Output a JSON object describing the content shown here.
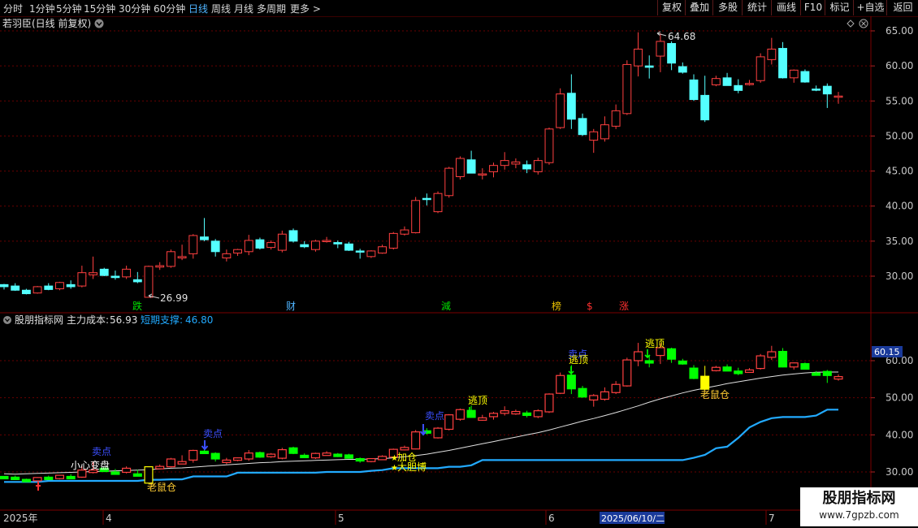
{
  "toolbar": {
    "periods": [
      "分时",
      "1分钟",
      "5分钟",
      "15分钟",
      "30分钟",
      "60分钟",
      "日线",
      "周线",
      "月线",
      "多周期",
      "更多"
    ],
    "active_period": "日线",
    "right_buttons": [
      "复权",
      "叠加",
      "多股",
      "统计",
      "画线",
      "F10",
      "标记",
      "+自选",
      "返回"
    ]
  },
  "main_panel": {
    "title": "若羽臣(日线 前复权)",
    "y_axis": {
      "min": 26,
      "max": 66,
      "ticks": [
        "65.00",
        "60.00",
        "55.00",
        "50.00",
        "45.00",
        "40.00",
        "35.00",
        "30.00"
      ]
    },
    "high_label": "64.68",
    "low_label": "26.99",
    "event_markers": [
      {
        "label": "跌",
        "color": "#00e000"
      },
      {
        "label": "财",
        "color": "#4fb4ff"
      },
      {
        "label": "減",
        "color": "#00e000"
      },
      {
        "label": "榜",
        "color": "#e8c000"
      },
      {
        "label": "$",
        "color": "#ff3030"
      },
      {
        "label": "涨",
        "color": "#ff3030"
      }
    ]
  },
  "indicator_panel": {
    "name": "股朋指标网",
    "main_cost_label": "主力成本:",
    "main_cost_value": "56.93",
    "support_label": "短期支撑:",
    "support_value": "46.80",
    "current_value_badge": "60.15",
    "y_axis": {
      "min": 26,
      "max": 64,
      "ticks": [
        "60.00",
        "50.00",
        "40.00",
        "30.00"
      ]
    },
    "signals": {
      "xiaoxin": "小心变盘",
      "maidian": "卖点",
      "laoshucang": "老鼠仓",
      "jiacang": "加仓",
      "dadanbo": "大胆博",
      "taoding": "逃顶"
    }
  },
  "time_axis": {
    "labels": [
      "2025年",
      "4",
      "5",
      "6",
      "2025/06/10/二",
      "7"
    ],
    "highlighted": "2025/06/10/二"
  },
  "watermark": {
    "name": "股朋指标网",
    "url": "www.7gpzb.com"
  },
  "colors": {
    "up": "#ff4040",
    "down": "#54ffff",
    "green": "#00ff00",
    "yellow": "#ffff00",
    "support": "#22aaff",
    "cost": "#e0e0e0",
    "grid": "#6a0000"
  },
  "chart_data": {
    "type": "candlestick",
    "ohlc": [
      [
        28.8,
        28.9,
        28.1,
        28.5
      ],
      [
        28.6,
        29.0,
        27.9,
        28.0
      ],
      [
        28.0,
        28.2,
        27.4,
        27.5
      ],
      [
        27.6,
        28.6,
        27.5,
        28.5
      ],
      [
        28.6,
        29.0,
        28.0,
        28.1
      ],
      [
        28.2,
        29.2,
        28.0,
        29.1
      ],
      [
        28.8,
        29.4,
        28.2,
        28.5
      ],
      [
        28.6,
        31.5,
        28.4,
        30.5
      ],
      [
        30.2,
        32.8,
        29.6,
        30.5
      ],
      [
        31.0,
        31.2,
        30.0,
        30.1
      ],
      [
        30.0,
        30.8,
        29.5,
        29.8
      ],
      [
        29.9,
        31.5,
        29.6,
        31.0
      ],
      [
        29.5,
        30.6,
        29.0,
        29.2
      ],
      [
        26.99,
        31.5,
        26.99,
        31.4
      ],
      [
        31.3,
        32.0,
        30.9,
        31.5
      ],
      [
        31.4,
        33.8,
        31.2,
        33.5
      ],
      [
        32.6,
        34.5,
        32.3,
        32.8
      ],
      [
        33.2,
        36.0,
        32.5,
        35.8
      ],
      [
        35.6,
        38.3,
        35.0,
        35.2
      ],
      [
        35.0,
        35.3,
        32.8,
        33.5
      ],
      [
        32.6,
        33.8,
        32.1,
        33.2
      ],
      [
        33.3,
        33.9,
        32.9,
        33.8
      ],
      [
        33.5,
        35.9,
        33.0,
        35.1
      ],
      [
        35.2,
        35.5,
        33.8,
        34.0
      ],
      [
        34.1,
        35.1,
        33.8,
        34.8
      ],
      [
        33.7,
        36.5,
        33.4,
        36.0
      ],
      [
        36.5,
        36.8,
        34.8,
        35.0
      ],
      [
        34.5,
        35.0,
        34.0,
        34.2
      ],
      [
        33.8,
        35.2,
        33.5,
        35.0
      ],
      [
        35.0,
        35.6,
        34.8,
        35.1
      ],
      [
        34.8,
        35.1,
        34.0,
        34.6
      ],
      [
        34.6,
        34.9,
        33.6,
        33.7
      ],
      [
        33.6,
        33.9,
        32.5,
        33.5
      ],
      [
        32.8,
        33.7,
        32.6,
        33.6
      ],
      [
        33.3,
        34.5,
        33.2,
        34.2
      ],
      [
        34.0,
        36.3,
        33.8,
        36.1
      ],
      [
        36.0,
        37.1,
        35.8,
        36.6
      ],
      [
        36.2,
        41.3,
        36.1,
        40.8
      ],
      [
        41.1,
        41.8,
        40.1,
        41.0
      ],
      [
        39.2,
        42.1,
        39.0,
        41.8
      ],
      [
        41.5,
        45.6,
        41.2,
        45.4
      ],
      [
        44.2,
        47.1,
        43.8,
        46.8
      ],
      [
        46.6,
        47.9,
        44.8,
        44.7
      ],
      [
        44.6,
        45.4,
        43.8,
        44.6
      ],
      [
        44.9,
        46.2,
        44.1,
        45.8
      ],
      [
        45.8,
        47.7,
        45.2,
        46.5
      ],
      [
        46.0,
        46.8,
        45.4,
        46.3
      ],
      [
        45.9,
        46.5,
        44.7,
        45.3
      ],
      [
        44.9,
        46.9,
        44.5,
        46.5
      ],
      [
        46.2,
        51.2,
        45.9,
        51.0
      ],
      [
        51.2,
        56.8,
        51.0,
        56.0
      ],
      [
        56.1,
        58.8,
        51.0,
        52.4
      ],
      [
        52.5,
        53.2,
        50.0,
        50.2
      ],
      [
        49.4,
        51.0,
        47.6,
        50.6
      ],
      [
        49.6,
        52.8,
        49.2,
        51.6
      ],
      [
        51.4,
        54.5,
        51.0,
        53.6
      ],
      [
        53.2,
        60.8,
        53.0,
        60.2
      ],
      [
        60.0,
        64.8,
        58.5,
        62.4
      ],
      [
        60.0,
        61.5,
        58.2,
        59.8
      ],
      [
        61.4,
        64.68,
        59.1,
        63.5
      ],
      [
        63.2,
        63.5,
        59.4,
        60.4
      ],
      [
        59.9,
        60.5,
        58.9,
        59.1
      ],
      [
        58.0,
        58.8,
        55.0,
        55.2
      ],
      [
        55.8,
        58.6,
        52.0,
        52.3
      ],
      [
        57.3,
        58.6,
        57.1,
        58.2
      ],
      [
        58.3,
        59.0,
        57.8,
        57.2
      ],
      [
        57.2,
        58.1,
        56.1,
        56.5
      ],
      [
        57.4,
        58.0,
        57.2,
        57.5
      ],
      [
        57.9,
        61.8,
        57.6,
        61.3
      ],
      [
        60.9,
        64.0,
        60.2,
        62.4
      ],
      [
        62.5,
        63.4,
        58.2,
        58.3
      ],
      [
        58.3,
        59.5,
        57.6,
        59.4
      ],
      [
        59.2,
        59.5,
        57.6,
        57.7
      ],
      [
        56.7,
        57.2,
        56.4,
        56.6
      ],
      [
        57.1,
        57.5,
        54.0,
        56.0
      ],
      [
        55.6,
        56.3,
        54.6,
        55.7
      ]
    ],
    "main_cost": [
      29.5,
      29.4,
      29.5,
      29.6,
      29.7,
      29.8,
      29.9,
      30.0,
      30.1,
      30.2,
      30.3,
      30.4,
      30.5,
      30.6,
      30.8,
      31.0,
      31.1,
      31.3,
      31.5,
      31.7,
      31.9,
      32.1,
      32.3,
      32.5,
      32.6,
      32.8,
      32.9,
      33.0,
      33.1,
      33.2,
      33.3,
      33.4,
      33.4,
      33.5,
      33.6,
      33.8,
      34.1,
      34.4,
      34.8,
      35.3,
      35.8,
      36.4,
      37.0,
      37.6,
      38.2,
      38.8,
      39.4,
      40.0,
      40.6,
      41.3,
      42.1,
      42.9,
      43.7,
      44.4,
      45.2,
      46.0,
      46.9,
      47.8,
      48.8,
      49.7,
      50.5,
      51.3,
      52.0,
      52.6,
      53.2,
      53.8,
      54.3,
      54.8,
      55.3,
      55.7,
      56.1,
      56.4,
      56.7,
      56.9,
      56.93,
      56.93
    ],
    "short_support": [
      27.3,
      27.3,
      27.3,
      27.3,
      27.6,
      27.6,
      27.6,
      27.6,
      27.6,
      27.6,
      27.6,
      27.6,
      27.6,
      27.9,
      27.9,
      28.0,
      28.0,
      28.8,
      28.8,
      28.8,
      28.8,
      29.8,
      29.8,
      29.8,
      29.8,
      29.8,
      29.8,
      29.8,
      29.8,
      30.0,
      30.0,
      30.0,
      30.0,
      30.3,
      30.5,
      31.0,
      31.0,
      31.0,
      31.0,
      31.0,
      31.4,
      31.4,
      31.8,
      33.2,
      33.2,
      33.2,
      33.2,
      33.2,
      33.2,
      33.2,
      33.2,
      33.2,
      33.2,
      33.2,
      33.2,
      33.2,
      33.2,
      33.2,
      33.2,
      33.2,
      33.2,
      33.2,
      33.8,
      34.6,
      36.4,
      36.8,
      39.2,
      42.0,
      43.5,
      44.5,
      44.8,
      44.8,
      44.8,
      45.2,
      46.8,
      46.8
    ]
  }
}
